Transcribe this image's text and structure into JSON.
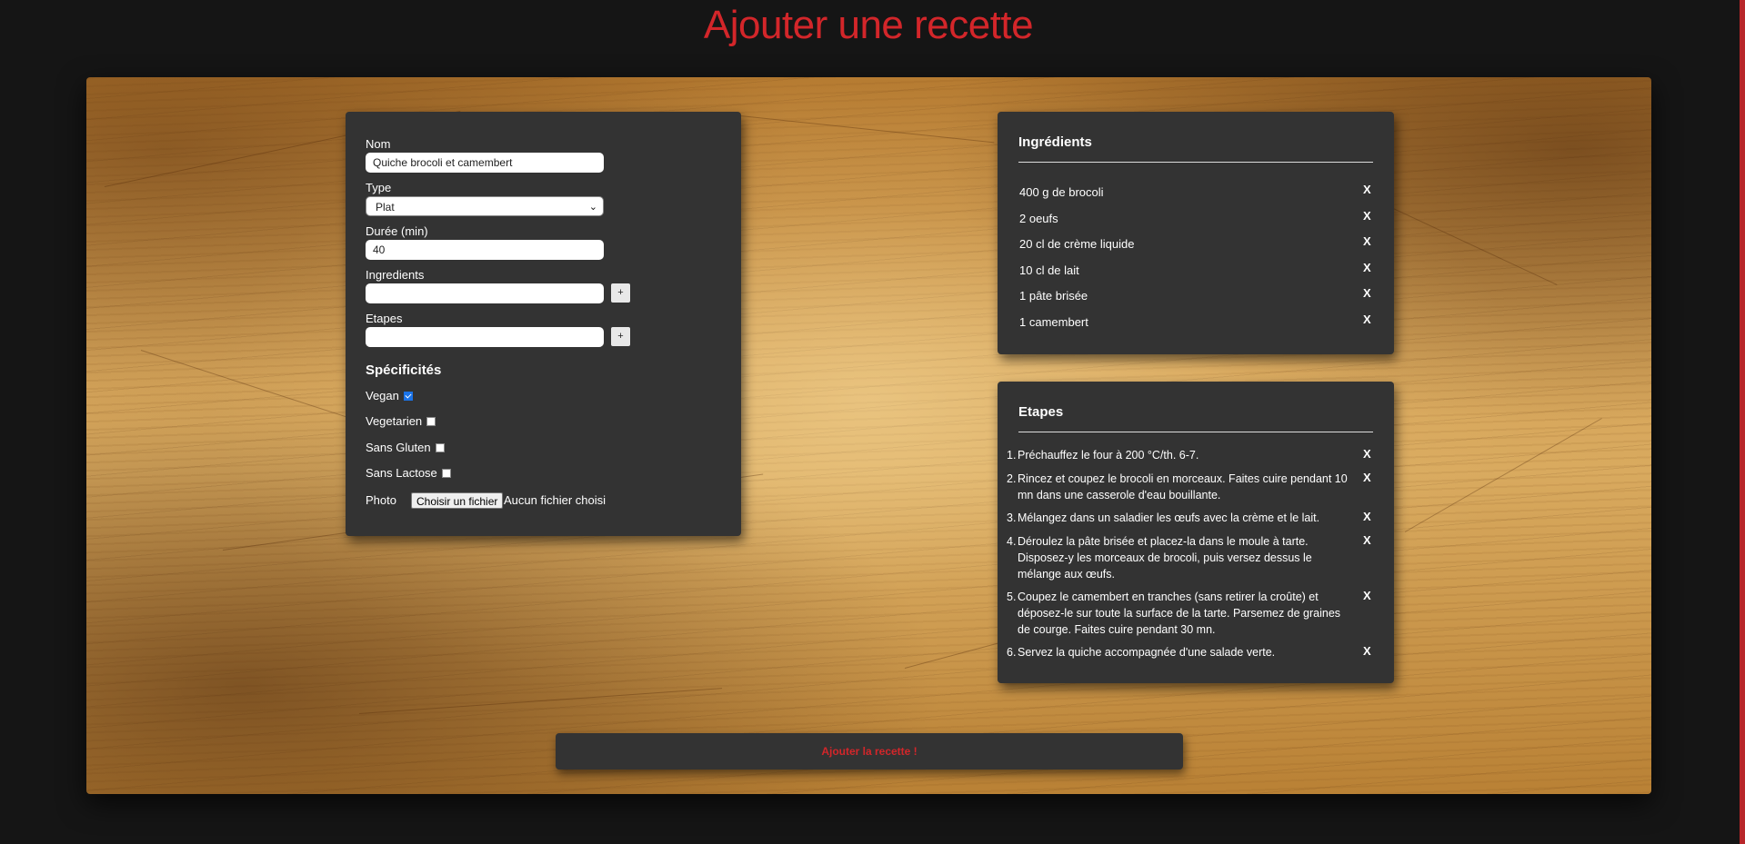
{
  "page": {
    "title": "Ajouter une recette",
    "accent_color": "#d3262a",
    "panel_color": "#333333"
  },
  "form": {
    "name_label": "Nom",
    "name_value": "Quiche brocoli et camembert",
    "type_label": "Type",
    "type_value": "Plat",
    "duration_label": "Durée (min)",
    "duration_value": "40",
    "ingredients_label": "Ingredients",
    "ingredients_value": "",
    "steps_label": "Etapes",
    "steps_value": "",
    "add_button_label": "+",
    "specificities_title": "Spécificités",
    "checkboxes": [
      {
        "label": "Vegan",
        "checked": true
      },
      {
        "label": "Vegetarien",
        "checked": false
      },
      {
        "label": "Sans Gluten",
        "checked": false
      },
      {
        "label": "Sans Lactose",
        "checked": false
      }
    ],
    "photo_label": "Photo",
    "file_button_label": "Choisir un fichier",
    "file_status": "Aucun fichier choisi"
  },
  "ingredients": {
    "title": "Ingrédients",
    "remove_label": "X",
    "items": [
      "400 g de brocoli",
      "2 oeufs",
      "20 cl de crème liquide",
      "10 cl de lait",
      "1 pâte brisée",
      "1 camembert"
    ]
  },
  "steps": {
    "title": "Etapes",
    "remove_label": "X",
    "items": [
      {
        "num": "1.",
        "text": "Préchauffez le four à 200 °C/th. 6-7."
      },
      {
        "num": "2.",
        "text": "Rincez et coupez le brocoli en morceaux. Faites cuire pendant 10 mn dans une casserole d'eau bouillante."
      },
      {
        "num": "3.",
        "text": "Mélangez dans un saladier les œufs avec la crème et le lait."
      },
      {
        "num": "4.",
        "text": "Déroulez la pâte brisée et placez-la dans le moule à tarte. Disposez-y les morceaux de brocoli, puis versez dessus le mélange aux œufs."
      },
      {
        "num": "5.",
        "text": "Coupez le camembert en tranches (sans retirer la croûte) et déposez-le sur toute la surface de la tarte. Parsemez de graines de courge. Faites cuire pendant 30 mn."
      },
      {
        "num": "6.",
        "text": "Servez la quiche accompagnée d'une salade verte."
      }
    ]
  },
  "submit": {
    "label": "Ajouter la recette !"
  }
}
